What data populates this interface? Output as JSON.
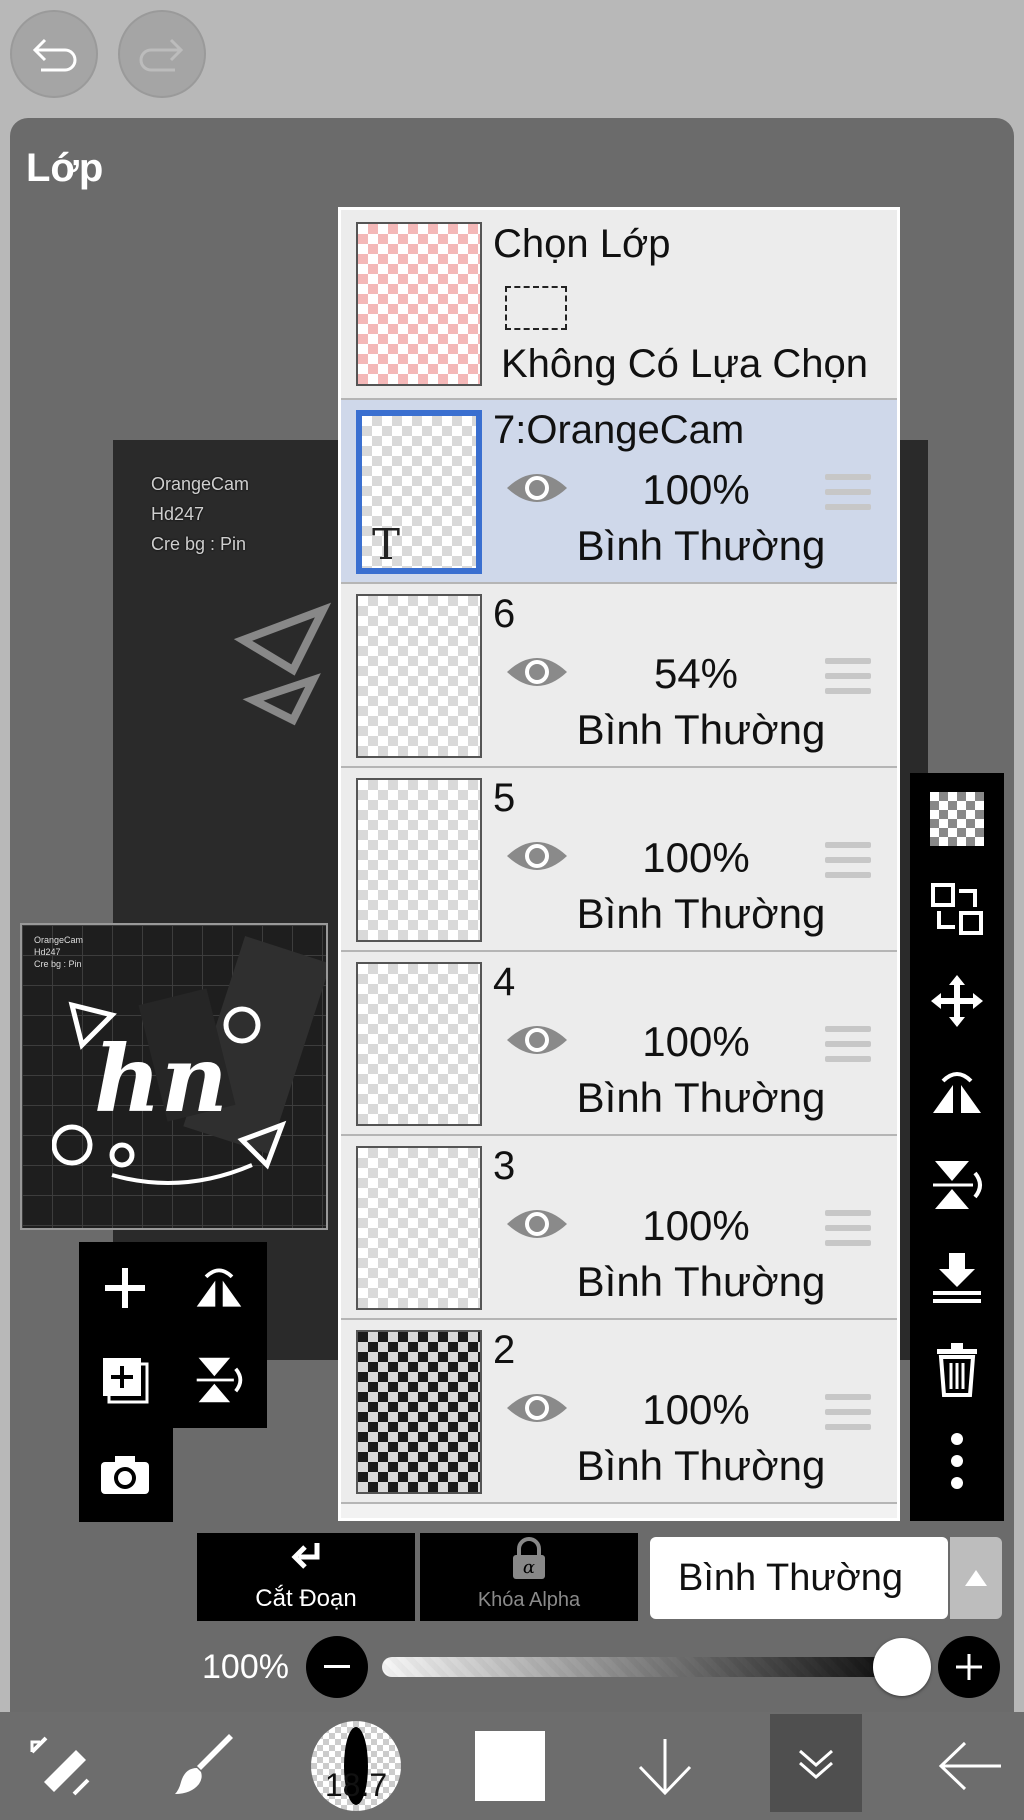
{
  "panel": {
    "title": "Lớp"
  },
  "canvas": {
    "texts": [
      "OrangeCam",
      "Hd247",
      "Cre bg : Pin"
    ],
    "preview_texts": [
      "OrangeCam",
      "Hd247",
      "Cre bg : Pin"
    ],
    "preview_art_text": "hn"
  },
  "selection": {
    "title": "Chọn Lớp",
    "status": "Không Có Lựa Chọn"
  },
  "layers": [
    {
      "name": "7:OrangeCam",
      "opacity": "100%",
      "blend": "Bình Thường",
      "selected": true,
      "thumb_label": "T"
    },
    {
      "name": "6",
      "opacity": "54%",
      "blend": "Bình Thường",
      "selected": false
    },
    {
      "name": "5",
      "opacity": "100%",
      "blend": "Bình Thường",
      "selected": false
    },
    {
      "name": "4",
      "opacity": "100%",
      "blend": "Bình Thường",
      "selected": false
    },
    {
      "name": "3",
      "opacity": "100%",
      "blend": "Bình Thường",
      "selected": false
    },
    {
      "name": "2",
      "opacity": "100%",
      "blend": "Bình Thường",
      "selected": false
    }
  ],
  "bottom": {
    "clip_label": "Cắt Đoạn",
    "alpha_lock_label": "Khóa Alpha",
    "blend_mode": "Bình Thường",
    "opacity_label": "100%",
    "opacity_value": 1.0
  },
  "toolbar": {
    "brush_size": "18.7"
  },
  "icons": [
    "undo-icon",
    "redo-icon",
    "transparent-bg-icon",
    "layer-swap-icon",
    "move-icon",
    "flip-horizontal-icon",
    "flip-vertical-icon",
    "merge-down-icon",
    "trash-icon",
    "more-icon",
    "add-layer-icon",
    "flip-icon",
    "add-copy-layer-icon",
    "rotate-icon",
    "camera-icon",
    "clip-arrow-icon",
    "lock-icon",
    "minus-icon",
    "plus-icon",
    "select-tool-icon",
    "brush-icon",
    "down-arrow-icon",
    "collapse-icon",
    "back-arrow-icon"
  ],
  "colors": {
    "selection_blue": "#3a6fd0",
    "selected_row": "#cfd8ea",
    "selection_thumb_pink": "#f4b8b8"
  }
}
